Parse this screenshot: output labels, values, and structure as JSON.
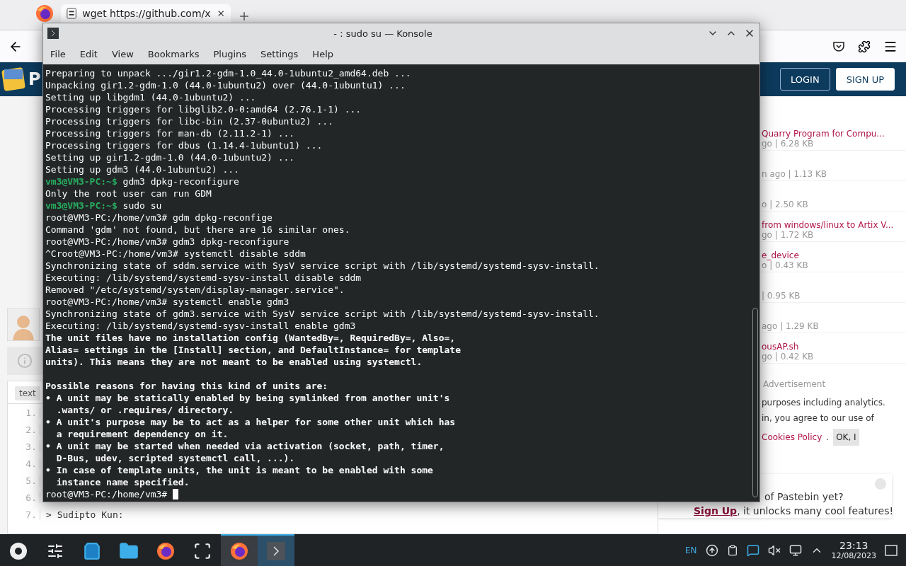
{
  "browser": {
    "tabs": [
      {
        "label": "wget https://github.com/x",
        "selected": true
      }
    ],
    "header": {
      "logo_letter": "P",
      "login": "LOGIN",
      "signup": "SIGN UP"
    },
    "left": {
      "tag": "text",
      "line_numbers": [
        "1.",
        "2.",
        "3.",
        "4.",
        "5.",
        "6.",
        "7."
      ],
      "comment_line": "> Sudipto Kun:"
    },
    "sidebar": [
      {
        "title": "Quarry Program for Compu...",
        "meta": "go | 6.28 KB"
      },
      {
        "meta": "n ago | 1.13 KB"
      },
      {
        "meta": "o | 2.50 KB"
      },
      {
        "title": "from windows/linux to Artix V...",
        "meta": "go | 1.72 KB"
      },
      {
        "title": "e_device",
        "meta": "o | 0.43 KB"
      },
      {
        "meta": "| 0.95 KB"
      },
      {
        "meta": "ago | 1.29 KB"
      },
      {
        "title": "ousAP.sh",
        "meta": "go | 0.42 KB"
      }
    ],
    "advertisement": "Advertisement",
    "cookie": {
      "line_1": "purposes including analytics.",
      "line_2": "in, you agree to our use of",
      "link": "Cookies Policy",
      "after_link": ".",
      "button": "OK, I"
    },
    "signup_card": {
      "line_1": "of Pastebin yet?",
      "link": "Sign Up",
      "rest": ", it unlocks many cool features!"
    }
  },
  "konsole": {
    "title": "- : sudo su — Konsole",
    "menu": [
      "File",
      "Edit",
      "View",
      "Bookmarks",
      "Plugins",
      "Settings",
      "Help"
    ],
    "lines": [
      {
        "kind": "plain",
        "text": "Preparing to unpack .../gir1.2-gdm-1.0_44.0-1ubuntu2_amd64.deb ..."
      },
      {
        "kind": "plain",
        "text": "Unpacking gir1.2-gdm-1.0 (44.0-1ubuntu2) over (44.0-1ubuntu1) ..."
      },
      {
        "kind": "plain",
        "text": "Setting up libgdm1 (44.0-1ubuntu2) ..."
      },
      {
        "kind": "plain",
        "text": "Processing triggers for libglib2.0-0:amd64 (2.76.1-1) ..."
      },
      {
        "kind": "plain",
        "text": "Processing triggers for libc-bin (2.37-0ubuntu2) ..."
      },
      {
        "kind": "plain",
        "text": "Processing triggers for man-db (2.11.2-1) ..."
      },
      {
        "kind": "plain",
        "text": "Processing triggers for dbus (1.14.4-1ubuntu1) ..."
      },
      {
        "kind": "plain",
        "text": "Setting up gir1.2-gdm-1.0 (44.0-1ubuntu2) ..."
      },
      {
        "kind": "plain",
        "text": "Setting up gdm3 (44.0-1ubuntu2) ..."
      },
      {
        "kind": "prompt",
        "prompt": "vm3@VM3-PC:~$",
        "text": " gdm3 dpkg-reconfigure"
      },
      {
        "kind": "plain",
        "text": "Only the root user can run GDM"
      },
      {
        "kind": "prompt",
        "prompt": "vm3@VM3-PC:~$",
        "text": " sudo su"
      },
      {
        "kind": "plain",
        "text": "root@VM3-PC:/home/vm3# gdm dpkg-reconfige"
      },
      {
        "kind": "plain",
        "text": "Command 'gdm' not found, but there are 16 similar ones."
      },
      {
        "kind": "plain",
        "text": "root@VM3-PC:/home/vm3# gdm3 dpkg-reconfigure"
      },
      {
        "kind": "plain",
        "text": "^Croot@VM3-PC:/home/vm3# systemctl disable sddm"
      },
      {
        "kind": "plain",
        "text": "Synchronizing state of sddm.service with SysV service script with /lib/systemd/systemd-sysv-install."
      },
      {
        "kind": "plain",
        "text": "Executing: /lib/systemd/systemd-sysv-install disable sddm"
      },
      {
        "kind": "plain",
        "text": "Removed \"/etc/systemd/system/display-manager.service\"."
      },
      {
        "kind": "plain",
        "text": "root@VM3-PC:/home/vm3# systemctl enable gdm3"
      },
      {
        "kind": "plain",
        "text": "Synchronizing state of gdm3.service with SysV service script with /lib/systemd/systemd-sysv-install."
      },
      {
        "kind": "plain",
        "text": "Executing: /lib/systemd/systemd-sysv-install enable gdm3"
      },
      {
        "kind": "bold",
        "text": "The unit files have no installation config (WantedBy=, RequiredBy=, Also=,"
      },
      {
        "kind": "bold",
        "text": "Alias= settings in the [Install] section, and DefaultInstance= for template"
      },
      {
        "kind": "bold",
        "text": "units). This means they are not meant to be enabled using systemctl."
      },
      {
        "kind": "blank"
      },
      {
        "kind": "bold",
        "text": "Possible reasons for having this kind of units are:"
      },
      {
        "kind": "bold",
        "text": "• A unit may be statically enabled by being symlinked from another unit's"
      },
      {
        "kind": "bold",
        "text": "  .wants/ or .requires/ directory."
      },
      {
        "kind": "bold",
        "text": "• A unit's purpose may be to act as a helper for some other unit which has"
      },
      {
        "kind": "bold",
        "text": "  a requirement dependency on it."
      },
      {
        "kind": "bold",
        "text": "• A unit may be started when needed via activation (socket, path, timer,"
      },
      {
        "kind": "bold",
        "text": "  D-Bus, udev, scripted systemctl call, ...)."
      },
      {
        "kind": "bold",
        "text": "• In case of template units, the unit is meant to be enabled with some"
      },
      {
        "kind": "bold",
        "text": "  instance name specified."
      },
      {
        "kind": "cursor",
        "text": "root@VM3-PC:/home/vm3# "
      }
    ]
  },
  "taskbar": {
    "tasks": [
      {
        "kind": "launcher",
        "active": false
      },
      {
        "kind": "settings",
        "active": false
      },
      {
        "kind": "store",
        "active": false
      },
      {
        "kind": "files",
        "active": false
      },
      {
        "kind": "firefox",
        "active": false
      },
      {
        "kind": "screenshot",
        "active": false
      },
      {
        "kind": "firefox",
        "active": true
      },
      {
        "kind": "terminal",
        "active": true
      }
    ],
    "language": "EN",
    "time": "23:13",
    "date": "12/08/2023"
  }
}
